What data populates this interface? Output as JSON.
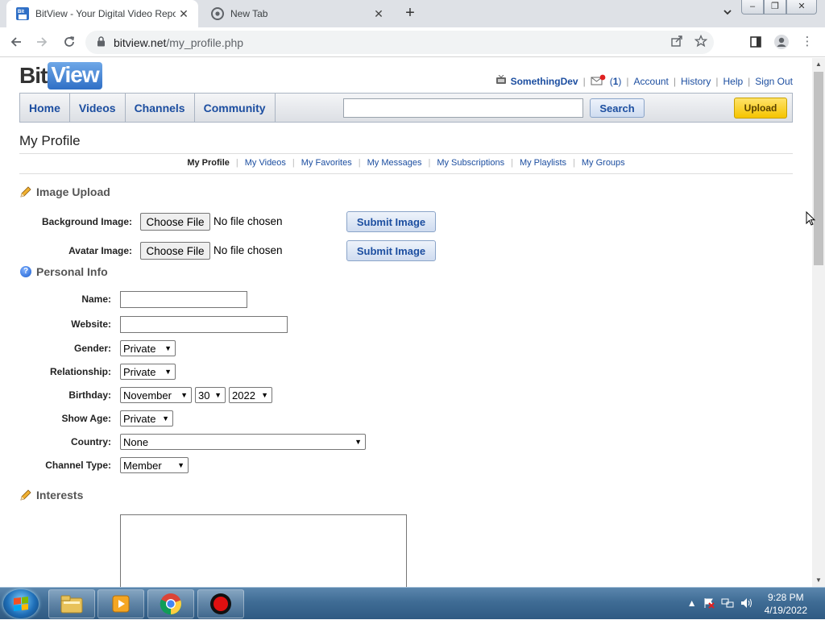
{
  "browser": {
    "tabs": [
      {
        "title": "BitView - Your Digital Video Repo",
        "active": true
      },
      {
        "title": "New Tab",
        "active": false
      }
    ],
    "url_host": "bitview.net",
    "url_path": "/my_profile.php"
  },
  "site": {
    "logo_bit": "Bit",
    "logo_view": "View",
    "user": {
      "username": "SomethingDev",
      "message_count": "1",
      "links": [
        "Account",
        "History",
        "Help",
        "Sign Out"
      ]
    },
    "nav": [
      "Home",
      "Videos",
      "Channels",
      "Community"
    ],
    "search_button": "Search",
    "upload_button": "Upload"
  },
  "page": {
    "title": "My Profile",
    "subnav": [
      "My Profile",
      "My Videos",
      "My Favorites",
      "My Messages",
      "My Subscriptions",
      "My Playlists",
      "My Groups"
    ],
    "image_upload": {
      "heading": "Image Upload",
      "background_label": "Background Image:",
      "avatar_label": "Avatar Image:",
      "choose_file": "Choose File",
      "no_file": "No file chosen",
      "submit": "Submit Image"
    },
    "personal_info": {
      "heading": "Personal Info",
      "name_label": "Name:",
      "name_value": "",
      "website_label": "Website:",
      "website_value": "",
      "gender_label": "Gender:",
      "gender_value": "Private",
      "relationship_label": "Relationship:",
      "relationship_value": "Private",
      "birthday_label": "Birthday:",
      "birthday_month": "November",
      "birthday_day": "30",
      "birthday_year": "2022",
      "show_age_label": "Show Age:",
      "show_age_value": "Private",
      "country_label": "Country:",
      "country_value": "None",
      "channel_type_label": "Channel Type:",
      "channel_type_value": "Member"
    },
    "interests": {
      "heading": "Interests",
      "value": ""
    }
  },
  "taskbar": {
    "time": "9:28 PM",
    "date": "4/19/2022"
  },
  "colors": {
    "link_blue": "#1c4ea0",
    "upload_yellow": "#f5c400",
    "taskbar": "#3f6c95"
  }
}
